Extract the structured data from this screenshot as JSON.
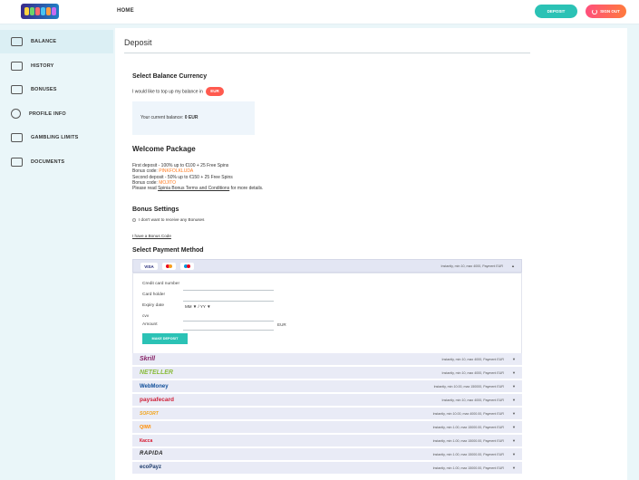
{
  "header": {
    "nav_home": "HOME",
    "deposit_button": "DEPOSIT",
    "signout_button": "SIGN OUT"
  },
  "sidebar": {
    "items": [
      {
        "label": "BALANCE",
        "icon": "wallet-icon",
        "active": true
      },
      {
        "label": "HISTORY",
        "icon": "history-icon"
      },
      {
        "label": "BONUSES",
        "icon": "gift-icon"
      },
      {
        "label": "PROFILE INFO",
        "icon": "profile-icon"
      },
      {
        "label": "GAMBLING LIMITS",
        "icon": "limits-icon"
      },
      {
        "label": "DOCUMENTS",
        "icon": "documents-icon"
      }
    ]
  },
  "main": {
    "title": "Deposit",
    "currency": {
      "heading": "Select Balance Currency",
      "prompt": "I would like to top up my balance in",
      "badge": "EUR",
      "balance_label": "Your current balance:",
      "balance_value": "0 EUR"
    },
    "welcome": {
      "heading": "Welcome Package",
      "line1": "First deposit - 100% up to €100 + 25 Free Spins",
      "code1_label": "Bonus code:",
      "code1": "PINKFOLKLUDA",
      "line2": "Second deposit - 50% up to €150 + 25 Free Spins",
      "code2_label": "Bonus code:",
      "code2": "MOJITO",
      "read_prefix": "Please read",
      "terms_link": "Spinia Bonus Terms and Conditions",
      "read_suffix": "for more details."
    },
    "bonus": {
      "heading": "Bonus Settings",
      "no_bonus": "I don't want to receive any Bonuses",
      "have_code": "I have a Bonus Code"
    },
    "payment": {
      "heading": "Select Payment Method",
      "card_logos": [
        "VISA",
        "MC",
        "Maestro"
      ],
      "card_info": "Instantly, min 10, max 4000, Payment EUR",
      "form": {
        "card_number": "Credit card number",
        "card_holder": "Card holder",
        "expiry": "Expiry date",
        "expiry_mm": "MM ▼",
        "expiry_sep": "/",
        "expiry_yy": "YY ▼",
        "cvv": "cvv",
        "amount": "Amount",
        "currency": "EUR",
        "submit": "MAKE DEPOSIT"
      },
      "providers": [
        {
          "name": "Skrill",
          "info": "Instantly, min 10, max 4000, Payment EUR"
        },
        {
          "name": "NETELLER",
          "info": "Instantly, min 10, max 4000, Payment EUR"
        },
        {
          "name": "WebMoney",
          "info": "Instantly, min 10.00, max 150000, Payment EUR"
        },
        {
          "name": "paysafecard",
          "info": "Instantly, min 10, max 4000, Payment EUR"
        },
        {
          "name": "SOFORT",
          "info": "Instantly, min 10.00, max 4000.00, Payment EUR"
        },
        {
          "name": "QIWI",
          "info": "Instantly, min 1.00, max 15000.00, Payment EUR"
        },
        {
          "name": "Касса",
          "info": "Instantly, min 1.00, max 15000.00, Payment EUR"
        },
        {
          "name": "RAPIDA",
          "info": "Instantly, min 1.00, max 15000.00, Payment EUR"
        },
        {
          "name": "ecoPayz",
          "info": "Instantly, min 1.00, max 15000.00, Payment EUR"
        }
      ]
    }
  },
  "colors": {
    "accent": "#2bc2b5",
    "signout": "#ff4f7c",
    "badge": "#ff5a4f",
    "bonus_code": "#ff7a1f"
  }
}
